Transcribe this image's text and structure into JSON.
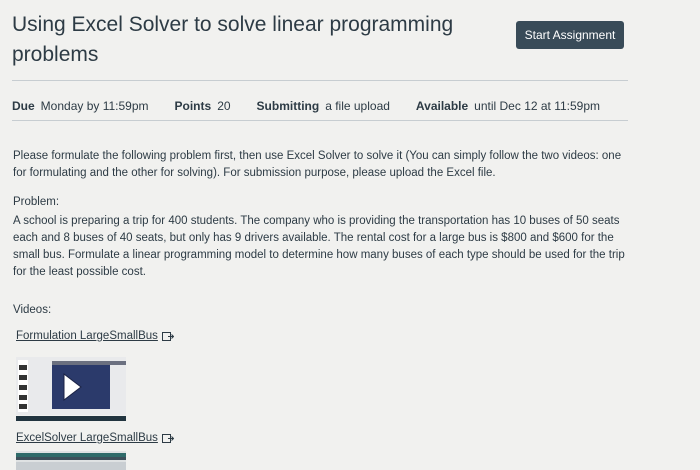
{
  "assignment": {
    "title": "Using Excel Solver to solve linear programming problems",
    "start_button_label": "Start Assignment"
  },
  "details": {
    "due_label": "Due",
    "due_value": "Monday by 11:59pm",
    "points_label": "Points",
    "points_value": "20",
    "submitting_label": "Submitting",
    "submitting_value": "a file upload",
    "available_label": "Available",
    "available_value": "until Dec 12 at 11:59pm"
  },
  "description": {
    "intro": "Please formulate the following problem first, then use Excel Solver to solve it (You can simply follow the two videos: one for formulating and the other for solving). For submission purpose, please upload the Excel file.",
    "problem_heading": "Problem:",
    "problem_text": "A school is preparing a trip for 400 students. The company who is providing the transportation has 10 buses of 50 seats each and 8 buses of 40 seats, but only has 9 drivers available. The rental cost for a large bus is $800 and $600 for the small bus. Formulate a linear programming model to determine how many buses of each type should be used for the trip for the least possible cost.",
    "videos_heading": "Videos:"
  },
  "videos": [
    {
      "link_text": "Formulation LargeSmallBus",
      "icon": "external-link-icon"
    },
    {
      "link_text": "ExcelSolver LargeSmallBus",
      "icon": "external-link-icon"
    }
  ],
  "colors": {
    "background": "#f1f1ef",
    "text": "#2d3b45",
    "button": "#394b58",
    "rule": "#c7cdd1",
    "video_thumb": "#2b3a6b"
  }
}
